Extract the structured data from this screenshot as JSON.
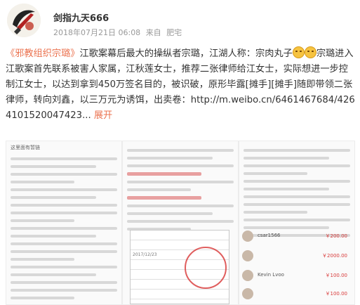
{
  "post": {
    "username": "剑指九天666",
    "timestamp": "2018年07月21日 06:08",
    "source_prefix": "来自",
    "source": "肥宅",
    "topic": "《邪教组织宗璐》",
    "text_1": "江歌案幕后最大的操纵者宗璐，江湖人称：宗肉丸子",
    "text_2": "宗璐进入江歌案首先联系被害人家属，江秋莲女士，推荐二张律师给江女士，实际想进一步控制江女士，以达到拿到450万签名目的，被识破，原形毕露",
    "tag_1": "[摊手]",
    "tag_2": "[摊手]",
    "text_3": "随即带领二张律师，转向刘鑫，以三万元为诱饵，出卖卷：",
    "url": "http://m.weibo.cn/6461467684/4264101520047423",
    "url_ellipsis": "...",
    "expand": "展开"
  },
  "images": {
    "img3_comments": [
      {
        "name": "csar1566",
        "price": "￥200.00"
      },
      {
        "name": "",
        "price": "￥2000.00"
      },
      {
        "name": "Kevin Lvoo",
        "price": "￥100.00"
      },
      {
        "name": "",
        "price": "￥100.00"
      }
    ],
    "img2_date": "2017/12/23",
    "img1_caption": "这里面有暂链"
  }
}
